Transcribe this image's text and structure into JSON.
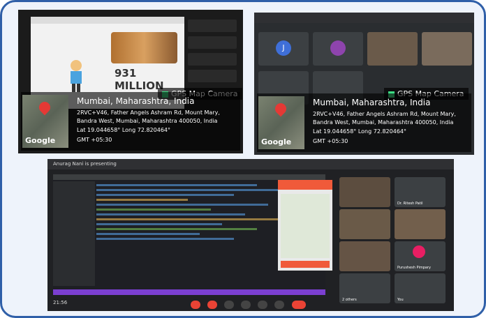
{
  "gps": {
    "tag": "GPS Map Camera",
    "city": "Mumbai, Maharashtra, India",
    "address": "2RVC+V46, Father Angels Ashram Rd, Mount Mary, Bandra West, Mumbai, Maharashtra 400050, India",
    "latlong": "Lat 19.044658° Long 72.820464°",
    "gmt": "GMT +05:30",
    "google": "Google"
  },
  "slide": {
    "big_number": "931 MILLION"
  },
  "meeting2": {
    "avatar_letter": "J"
  },
  "meeting3": {
    "header": "Anurag Nani is presenting",
    "time": "21:56",
    "participants": [
      {
        "name": ""
      },
      {
        "name": "Dr. Ritesh Patil"
      },
      {
        "name": ""
      },
      {
        "name": ""
      },
      {
        "name": ""
      },
      {
        "name": "Purushesh Pimpary"
      },
      {
        "name": "2 others"
      },
      {
        "name": "You"
      }
    ]
  }
}
